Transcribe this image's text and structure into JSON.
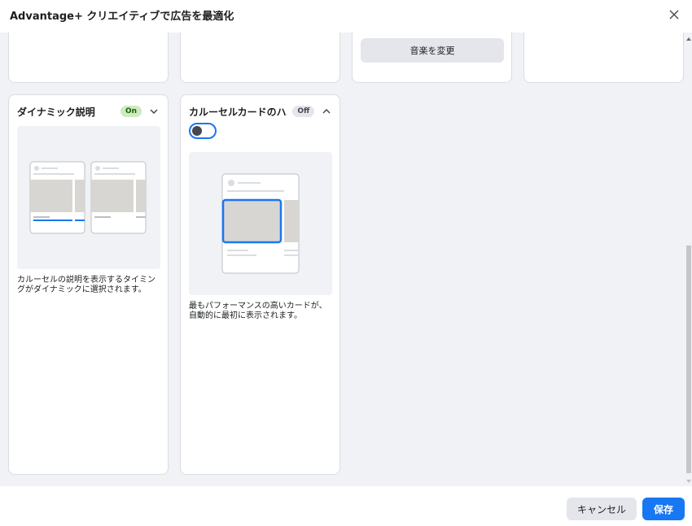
{
  "header": {
    "title": "Advantage+ クリエイティブで広告を最適化",
    "close_icon": "close-icon"
  },
  "top_cards": {
    "music_button_label": "音楽を変更"
  },
  "cards": [
    {
      "title": "ダイナミック説明",
      "status": "On",
      "expanded": false,
      "description_line1": "カルーセルの説明を表示するタイミン",
      "description_line2": "グがダイナミックに選択されます。"
    },
    {
      "title": "カルーセルカードのハ...",
      "status": "Off",
      "expanded": true,
      "toggle_on": false,
      "description_line1": "最もパフォーマンスの高いカードが、",
      "description_line2": "自動的に最初に表示されます。"
    }
  ],
  "footer": {
    "cancel_label": "キャンセル",
    "save_label": "保存"
  },
  "colors": {
    "primary": "#1877f2",
    "badge_on_bg": "#cdeac0",
    "badge_on_text": "#1e5a0e",
    "background": "#f0f2f5"
  }
}
